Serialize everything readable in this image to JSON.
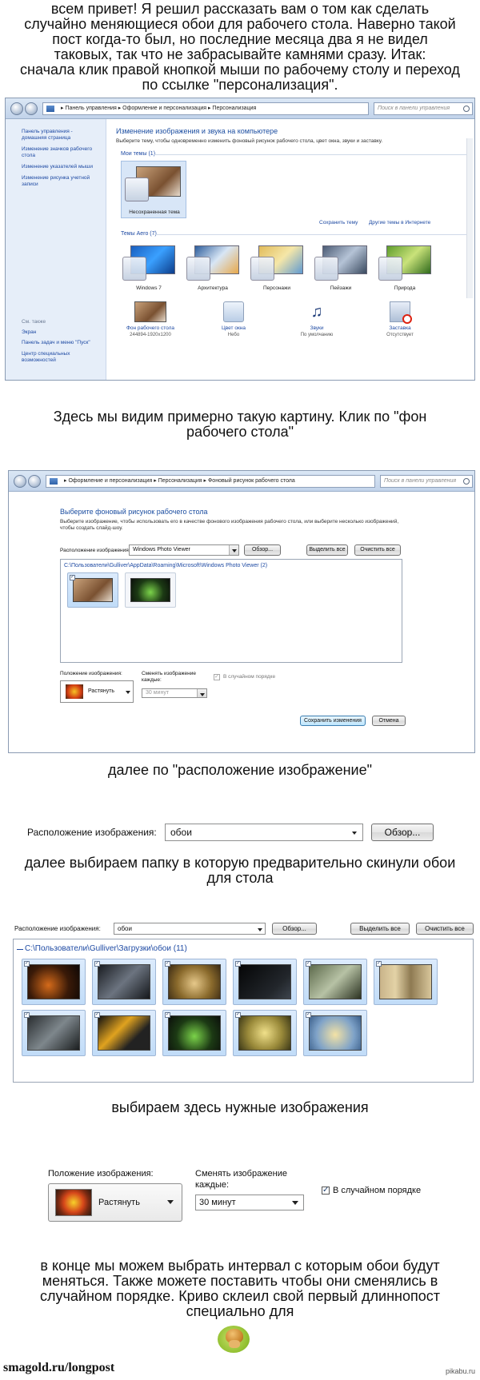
{
  "intro": {
    "lines": [
      "всем привет! Я решил рассказать вам о том как сделать",
      "случайно меняющиеся обои для рабочего стола. Наверно такой",
      "пост когда-то был, но последние месяца два я не видел",
      "таковых, так что не забрасывайте камнями сразу. Итак:",
      "сначала клик правой кнопкой мыши по рабочему столу и переход",
      "по ссылке \"персонализация\"."
    ]
  },
  "shot1": {
    "breadcrumb": "▸ Панель управления ▸ Оформление и персонализация ▸ Персонализация",
    "search_placeholder": "Поиск в панели управления",
    "sidebar_links": [
      "Панель управления -",
      "домашняя страница",
      "Изменение значков рабочего",
      "стола",
      "Изменение указателей мыши",
      "Изменение рисунка учетной",
      "записи"
    ],
    "see_also_title": "См. также",
    "see_also": [
      "Экран",
      "Панель задач и меню \"Пуск\"",
      "Центр специальных",
      "возможностей"
    ],
    "title": "Изменение изображения и звука на компьютере",
    "subtitle": "Выберите тему, чтобы одновременно изменить фоновый рисунок рабочего стола, цвет окна, звуки и заставку.",
    "my_themes": "Мои темы (1)",
    "unsaved_theme": "Несохраненная тема",
    "save_theme": "Сохранить тему",
    "other_themes": "Другие темы в Интернете",
    "aero_themes": "Темы Aero (7)",
    "themes": [
      "Windows 7",
      "Архитектура",
      "Персонажи",
      "Пейзажи",
      "Природа"
    ],
    "bottom": [
      {
        "label": "Фон рабочего стола",
        "sub": "244894-1920x1200"
      },
      {
        "label": "Цвет окна",
        "sub": "Небо"
      },
      {
        "label": "Звуки",
        "sub": "По умолчанию"
      },
      {
        "label": "Заставка",
        "sub": "Отсутствует"
      }
    ]
  },
  "caption1": [
    "Здесь мы видим примерно такую картину. Клик по \"фон",
    "рабочего стола\""
  ],
  "shot2": {
    "breadcrumb": "▸ Оформление и персонализация ▸ Персонализация ▸ Фоновый рисунок рабочего стола",
    "search_placeholder": "Поиск в панели управления",
    "title": "Выберите фоновый рисунок рабочего стола",
    "subtitle1": "Выберите изображение, чтобы использовать его в качестве фонового изображения рабочего стола, или выберите несколько изображений,",
    "subtitle2": "чтобы создать слайд-шоу.",
    "location_label": "Расположение изображения:",
    "location_value": "Windows Photo Viewer",
    "browse": "Обзор...",
    "select_all": "Выделить все",
    "clear_all": "Очистить все",
    "folder": "C:\\Пользователи\\Gulliver\\AppData\\Roaming\\Microsoft\\Windows Photo Viewer (2)",
    "position_label": "Положение изображения:",
    "position_value": "Растянуть",
    "interval_label1": "Сменять изображение",
    "interval_label2": "каждые:",
    "interval_value": "30 минут",
    "shuffle": "В случайном порядке",
    "save": "Сохранить изменения",
    "cancel": "Отмена"
  },
  "caption2": "далее по \"расположение изображение\"",
  "shot3": {
    "label": "Расположение изображения:",
    "value": "обои",
    "browse": "Обзор..."
  },
  "caption3": [
    "далее выбираем папку в которую предварительно скинули обои",
    "для стола"
  ],
  "shot4": {
    "label": "Расположение изображения:",
    "value": "обои",
    "browse": "Обзор...",
    "select_all": "Выделить все",
    "clear_all": "Очистить все",
    "folder": "C:\\Пользователи\\Gulliver\\Загрузки\\обои (11)"
  },
  "caption4": "выбираем здесь нужные изображения",
  "shot5": {
    "position_label": "Положение изображения:",
    "position_value": "Растянуть",
    "interval_label1": "Сменять изображение",
    "interval_label2": "каждые:",
    "interval_value": "30 минут",
    "shuffle": "В случайном порядке"
  },
  "caption5": [
    "в конце мы можем выбрать интервал с которым обои будут",
    "меняться. Также можете поставить чтобы они сменялись в",
    "случайном порядке. Криво склеил свой первый длиннопост",
    "специально для"
  ],
  "footer": {
    "left": "smagold.ru/longpost",
    "right": "pikabu.ru"
  },
  "colors": {
    "link": "#1e4aa3",
    "title": "#1c4ea1",
    "frame": "#8a9bb3"
  }
}
